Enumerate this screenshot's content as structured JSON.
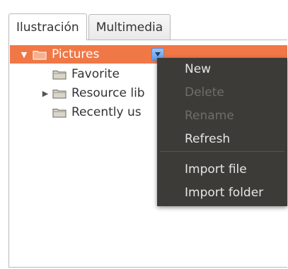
{
  "tabs": [
    {
      "label": "Ilustración",
      "active": true
    },
    {
      "label": "Multimedia",
      "active": false
    }
  ],
  "tree": {
    "root": {
      "label": "Pictures",
      "expanded": true,
      "selected": true
    },
    "children": [
      {
        "label": "Favorite",
        "has_children": false
      },
      {
        "label": "Resource lib",
        "has_children": true
      },
      {
        "label": "Recently us",
        "has_children": false
      }
    ]
  },
  "context_menu": {
    "items": [
      {
        "label": "New",
        "enabled": true
      },
      {
        "label": "Delete",
        "enabled": false
      },
      {
        "label": "Rename",
        "enabled": false
      },
      {
        "label": "Refresh",
        "enabled": true
      },
      {
        "label": "Import file",
        "enabled": true
      },
      {
        "label": "Import folder",
        "enabled": true
      }
    ]
  },
  "colors": {
    "selection": "#f07746",
    "menu_bg": "#3c3b37",
    "menu_text": "#e6e6e6",
    "menu_disabled": "#6f6e69"
  },
  "icons": {
    "folder": "folder-icon",
    "expander_open": "triangle-down-icon",
    "expander_closed": "triangle-right-icon",
    "dropdown": "chevron-down-icon"
  }
}
